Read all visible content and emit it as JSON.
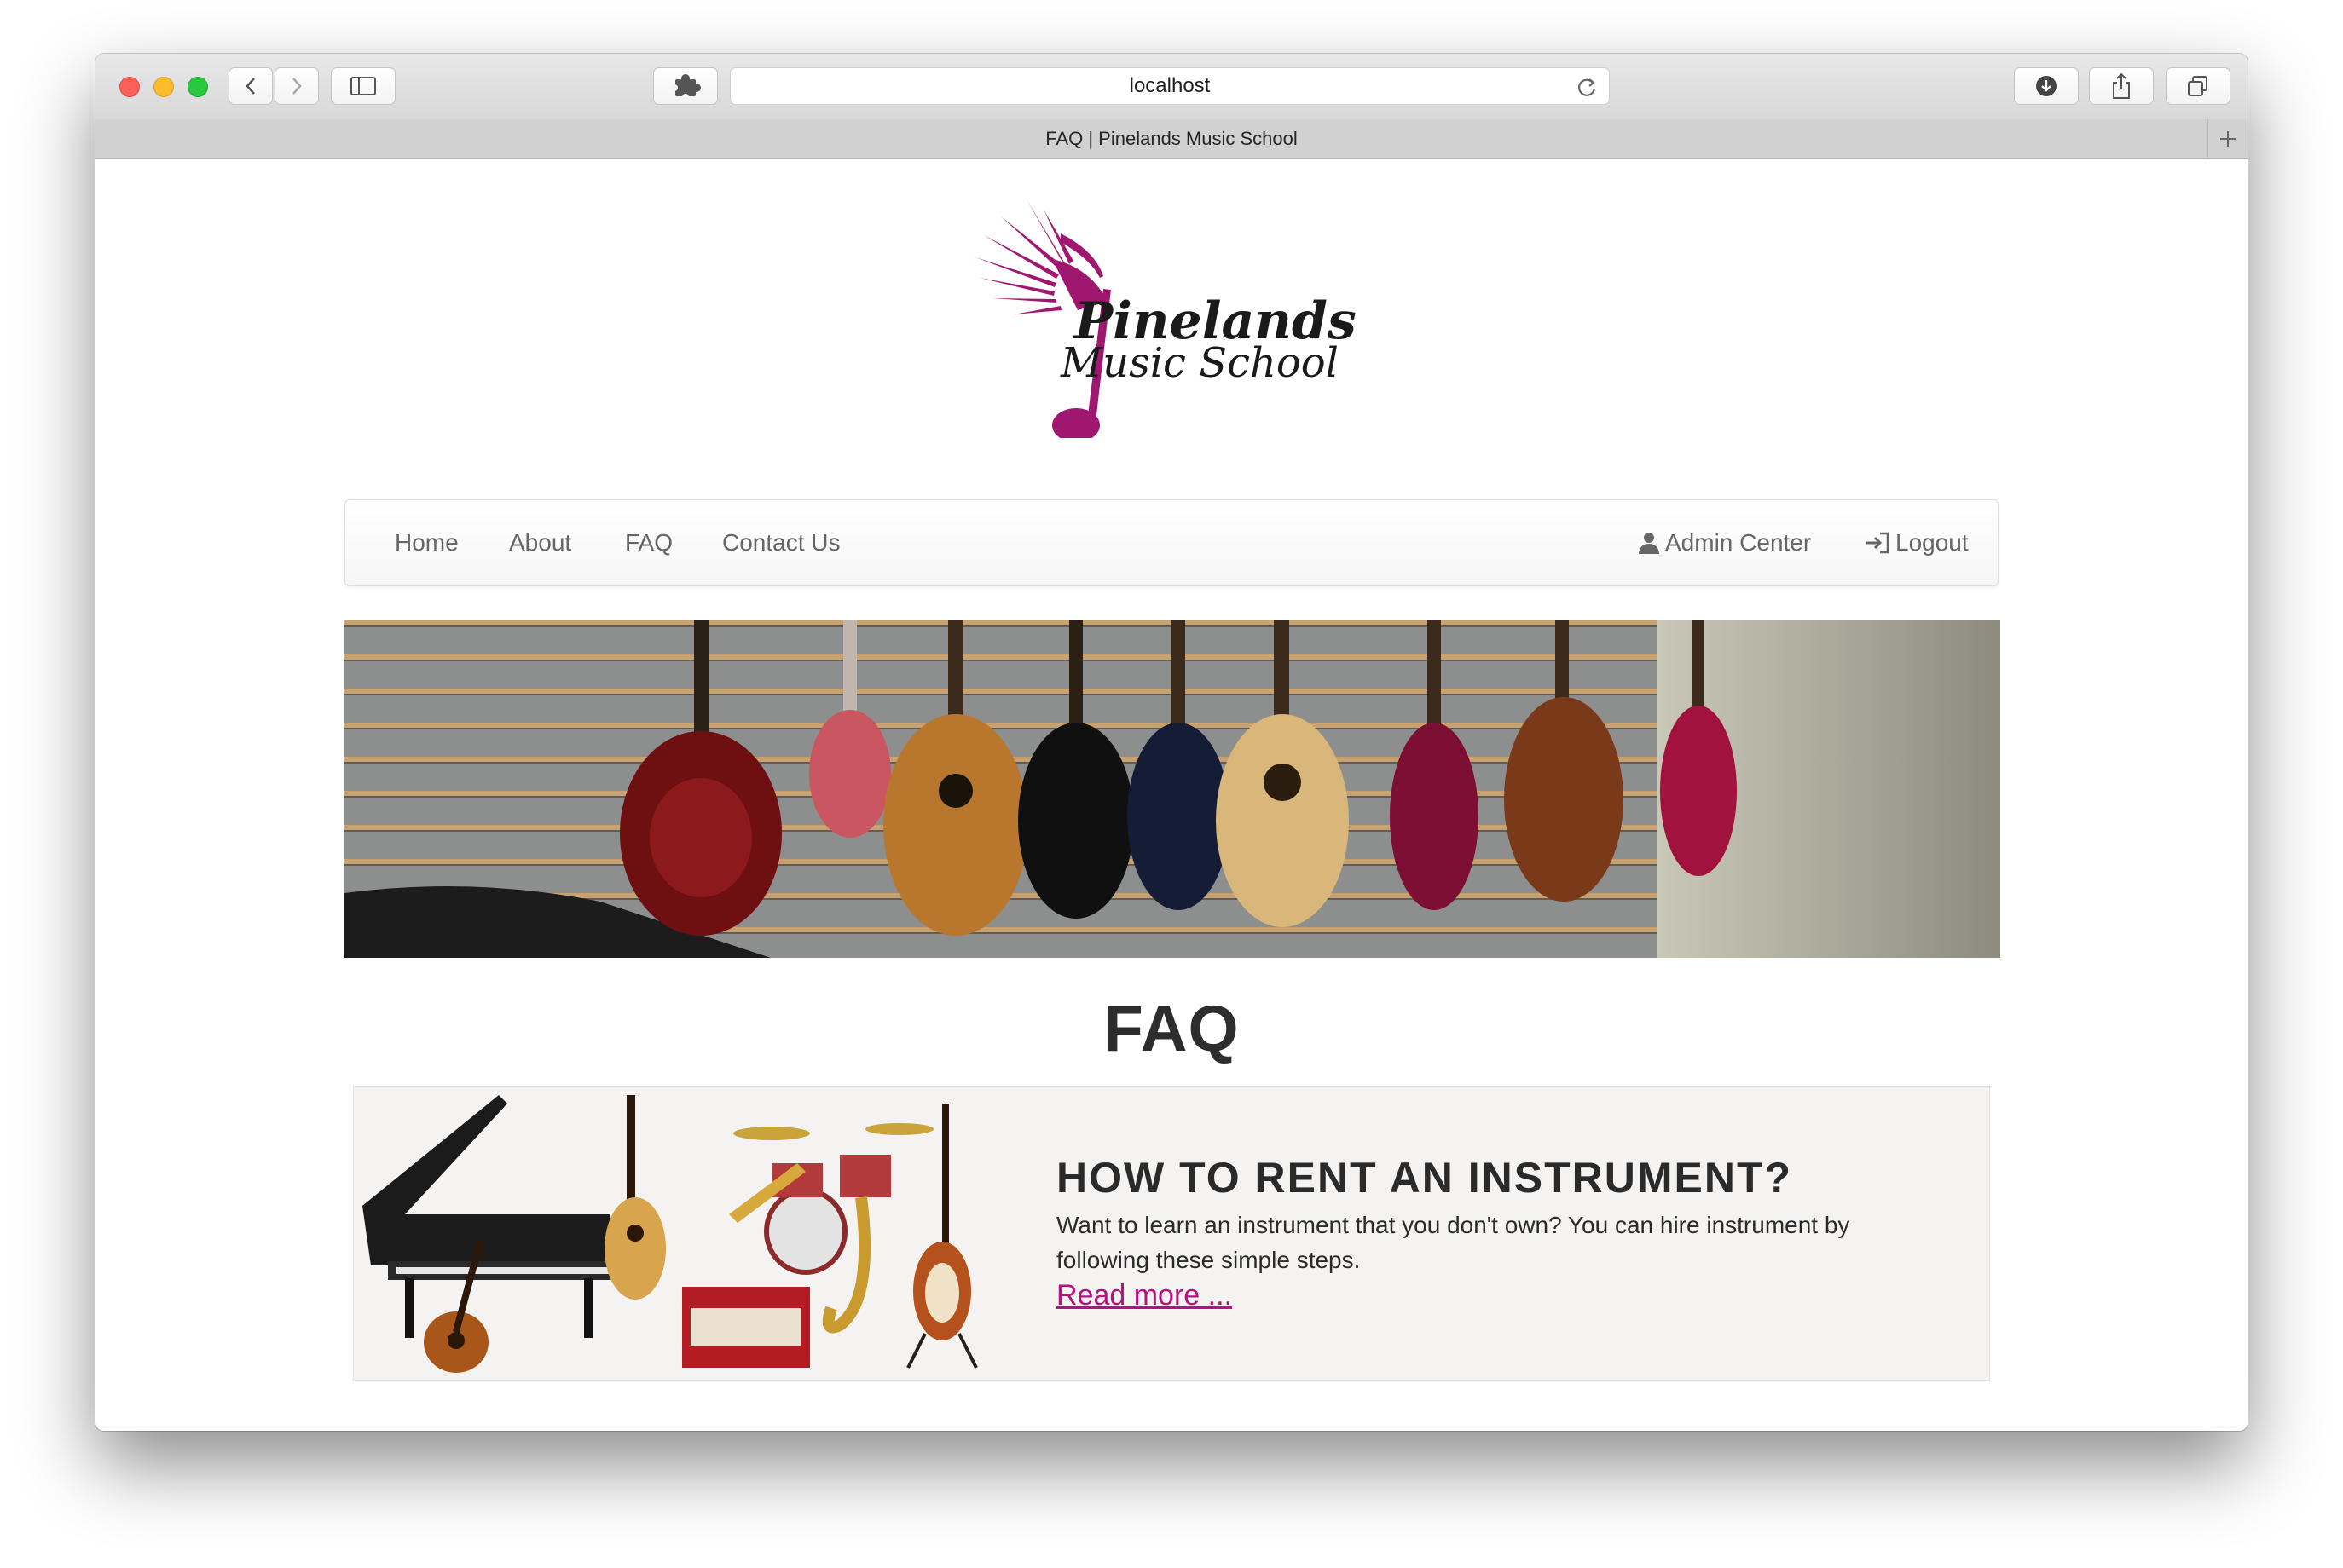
{
  "browser": {
    "url": "localhost",
    "tab_title": "FAQ | Pinelands Music School"
  },
  "logo": {
    "line1": "Pinelands",
    "line2": "Music School",
    "color": "#a0176f"
  },
  "nav": {
    "left": [
      "Home",
      "About",
      "FAQ",
      "Contact Us"
    ],
    "admin_label": "Admin Center",
    "logout_label": "Logout"
  },
  "main": {
    "title": "FAQ",
    "card": {
      "title": "HOW TO RENT AN INSTRUMENT?",
      "body": "Want to learn an instrument that you don't own? You can hire instrument by following these simple steps.",
      "link": "Read more ..."
    }
  },
  "colors": {
    "accent": "#b5117f",
    "card_bg": "#f4f3f1"
  }
}
